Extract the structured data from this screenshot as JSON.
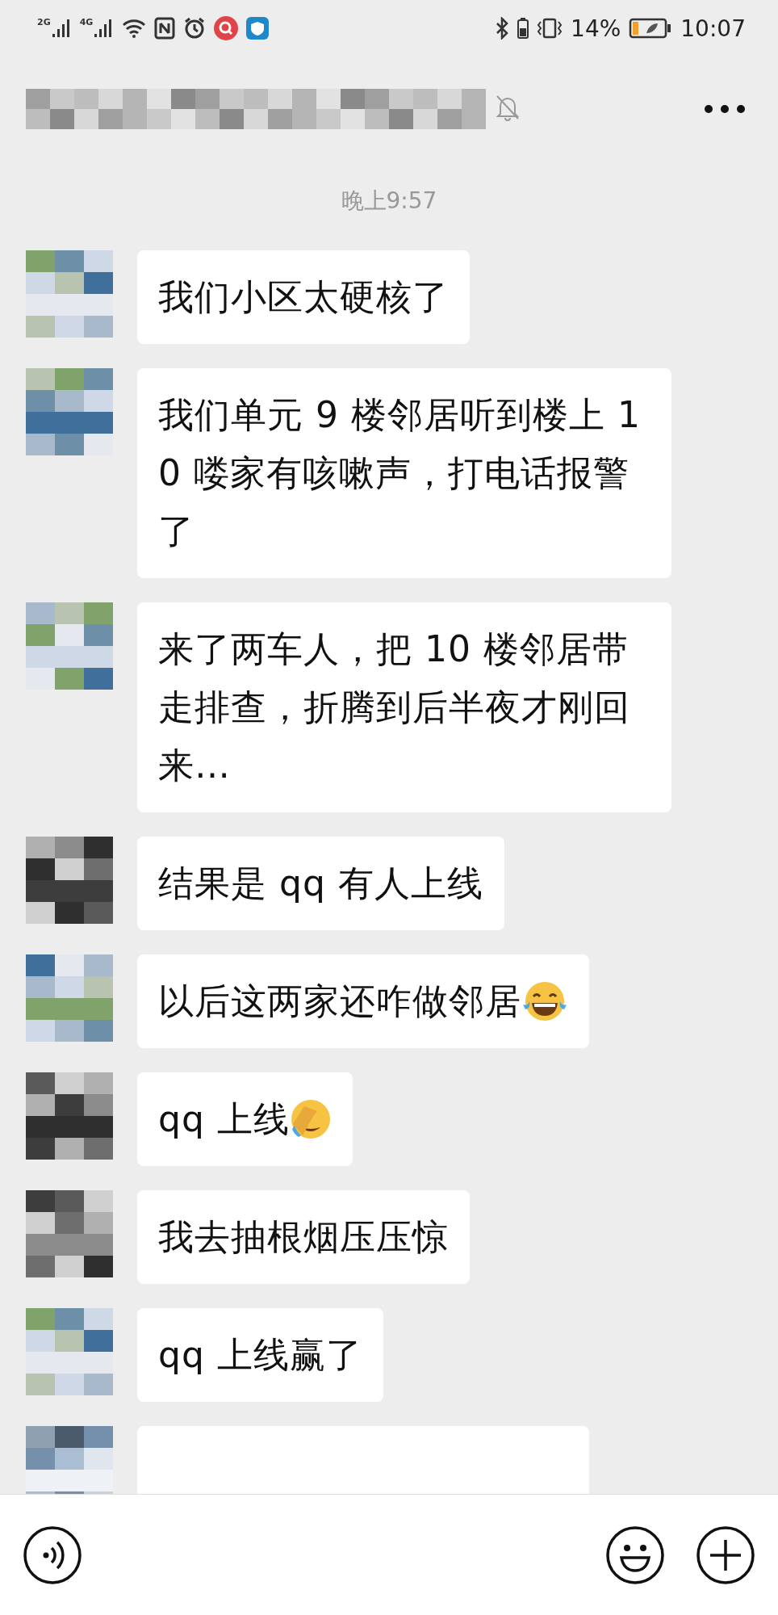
{
  "status_bar": {
    "sim_1": "2G",
    "sim_2": "4G",
    "battery_percent": "14%",
    "time": "10:07"
  },
  "header": {
    "muted": true
  },
  "timestamp": "晚上9:57",
  "messages": [
    {
      "kind": "text",
      "text": "我们小区太硬核了"
    },
    {
      "kind": "text",
      "text": "我们单元 9 楼邻居听到楼上 10 喽家有咳嗽声，打电话报警了"
    },
    {
      "kind": "text",
      "text": "来了两车人，把 10 楼邻居带走排查，折腾到后半夜才刚回来…"
    },
    {
      "kind": "text",
      "text": "结果是 qq 有人上线"
    },
    {
      "kind": "laughing",
      "text": "以后这两家还咋做邻居"
    },
    {
      "kind": "facepalm",
      "text": "qq 上线"
    },
    {
      "kind": "text",
      "text": "我去抽根烟压压惊"
    },
    {
      "kind": "text",
      "text": "qq 上线赢了"
    },
    {
      "kind": "cut"
    }
  ]
}
